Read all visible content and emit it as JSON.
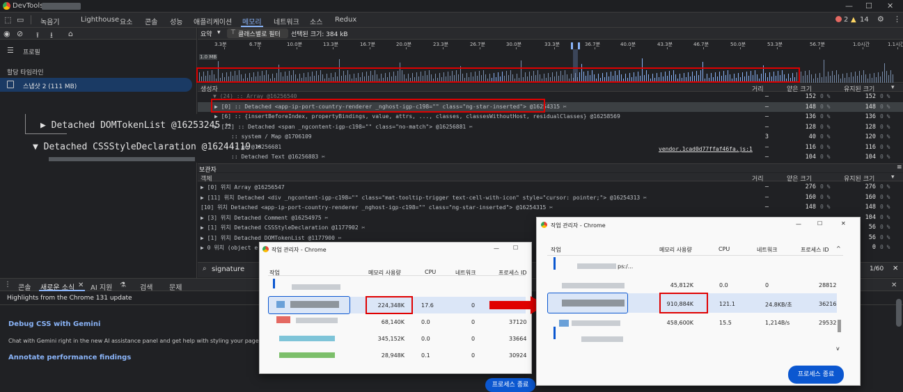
{
  "window": {
    "title": "DevTools - "
  },
  "tabs": [
    "녹음기",
    "Lighthouse",
    "요소",
    "콘솔",
    "성능",
    "애플리케이션",
    "메모리",
    "네트워크",
    "소스",
    "Redux"
  ],
  "issues": {
    "errors": "2",
    "warnings": "14"
  },
  "left": {
    "profiles_label": "프로필",
    "timeline_label": "할당 타임라인",
    "snapshot": "스냅샷 2 (111 MB)",
    "zoom1": "▶ Detached DOMTokenList @16253245 ✂",
    "zoom2": "▼ Detached CSSStyleDeclaration @16244119 ✂"
  },
  "toolbar": {
    "view": "요약",
    "filter": "클래스별로 필터",
    "selected_size": "선택된 크기: 384 kB"
  },
  "timeline": {
    "ticks": [
      "3.3분",
      "6.7분",
      "10.0분",
      "13.3분",
      "16.7분",
      "20.0분",
      "23.3분",
      "26.7분",
      "30.0분",
      "33.3분",
      "36.7분",
      "40.0분",
      "43.3분",
      "46.7분",
      "50.0분",
      "53.3분",
      "56.7분",
      "1.0시간",
      "1.1시간"
    ],
    "scale_label": "1.0 MB"
  },
  "constructor_grid": {
    "headers": {
      "name": "생성자",
      "distance": "거리",
      "shallow": "얕은 크기",
      "retained": "유지된 크기"
    },
    "rows": [
      {
        "text": "▼ (24) :: Array @16256540",
        "distance": "–",
        "shallow": "152",
        "sp": "0 %",
        "retained": "152",
        "rp": "0 %"
      },
      {
        "text": "▶ [0] :: Detached <app-ip-port-country-renderer _nghost-igp-c198=\"\" class=\"ng-star-inserted\"> @16254315 ✂",
        "distance": "–",
        "shallow": "148",
        "sp": "0 %",
        "retained": "148",
        "rp": "0 %"
      },
      {
        "text": "▶ [6] :: {insertBeforeIndex, propertyBindings, value, attrs, ..., classes, classesWithoutHost, residualClasses} @16258569",
        "distance": "–",
        "shallow": "136",
        "sp": "0 %",
        "retained": "136",
        "rp": "0 %"
      },
      {
        "text": "▶ [22] :: Detached <span _ngcontent-igp-c198=\"\" class=\"no-match\"> @16256881 ✂",
        "distance": "–",
        "shallow": "128",
        "sp": "0 %",
        "retained": "128",
        "rp": "0 %"
      },
      {
        "text": ":: system / Map @1706109",
        "distance": "3",
        "shallow": "40",
        "sp": "0 %",
        "retained": "120",
        "rp": "0 %"
      },
      {
        "text": ":: ge @16256681",
        "distance": "–",
        "shallow": "116",
        "sp": "0 %",
        "retained": "116",
        "rp": "0 %"
      },
      {
        "text": ":: Detached Text @16256883 ✂",
        "distance": "–",
        "shallow": "104",
        "sp": "0 %",
        "retained": "104",
        "rp": "0 %"
      }
    ],
    "link": "vendor.1cad0d77ffaf46fa.js:1"
  },
  "retainers_grid": {
    "title": "보관자",
    "headers": {
      "name": "객체",
      "distance": "거리",
      "shallow": "얕은 크기",
      "retained": "유지된 크기"
    },
    "rows": [
      {
        "text": "▶ [0] 위치 Array @16256547",
        "distance": "–",
        "shallow": "276",
        "sp": "0 %",
        "retained": "276",
        "rp": "0 %"
      },
      {
        "text": "▶ [11] 위치 Detached <div _ngcontent-igp-c198=\"\" class=\"mat-tooltip-trigger text-cell-with-icon\" style=\"cursor: pointer;\"> @16254313 ✂",
        "distance": "–",
        "shallow": "160",
        "sp": "0 %",
        "retained": "160",
        "rp": "0 %"
      },
      {
        "text": "[10] 위치 Detached <app-ip-port-country-renderer _nghost-igp-c198=\"\" class=\"ng-star-inserted\"> @16254315 ✂",
        "distance": "–",
        "shallow": "148",
        "sp": "0 %",
        "retained": "148",
        "rp": "0 %"
      },
      {
        "text": "▶ [3] 위치 Detached Comment @16254975 ✂",
        "distance": "–",
        "shallow": "",
        "sp": "",
        "retained": "104",
        "rp": "0 %"
      },
      {
        "text": "▶ [1] 위치 Detached CSSStyleDeclaration @1177902 ✂",
        "distance": "–",
        "shallow": "",
        "sp": "",
        "retained": "56",
        "rp": "0 %"
      },
      {
        "text": "▶ [1] 위치 Detached DOMTokenList @1177900 ✂",
        "distance": "–",
        "shallow": "",
        "sp": "",
        "retained": "56",
        "rp": "0 %"
      },
      {
        "text": "▶ 0 위치 (object e",
        "distance": "–",
        "shallow": "",
        "sp": "",
        "retained": "0",
        "rp": "0 %"
      }
    ]
  },
  "search": {
    "value": "signature",
    "count": "1/60"
  },
  "drawer": {
    "tabs": [
      "콘솔",
      "새로운 소식",
      "AI 지원",
      "검색",
      "문제"
    ],
    "highlights": "Highlights from the Chrome 131 update",
    "h1": "Debug CSS with Gemini",
    "p1": "Chat with Gemini right in the new AI assistance panel and get help with styling your page",
    "h2": "Annotate performance findings"
  },
  "tm1": {
    "title": "작업 관리자 - Chrome",
    "headers": {
      "task": "작업",
      "mem": "메모리 사용량",
      "cpu": "CPU",
      "net": "네트워크",
      "pid": "프로세스 ID"
    },
    "rows": [
      {
        "mem": "224,348K",
        "cpu": "17.6",
        "net": "0",
        "pid": ""
      },
      {
        "mem": "68,140K",
        "cpu": "0.0",
        "net": "0",
        "pid": "37120"
      },
      {
        "mem": "345,152K",
        "cpu": "0.0",
        "net": "0",
        "pid": "33664"
      },
      {
        "mem": "28,948K",
        "cpu": "0.1",
        "net": "0",
        "pid": "30924"
      }
    ],
    "end_btn": "프로세스 종료"
  },
  "tm2": {
    "title": "작업 관리자 - Chrome",
    "headers": {
      "task": "작업",
      "mem": "메모리 사용량",
      "cpu": "CPU",
      "net": "네트워크",
      "pid": "프로세스 ID"
    },
    "row0_text": "ps:/...",
    "rows": [
      {
        "mem": "45,812K",
        "cpu": "0.0",
        "net": "0",
        "pid": "28812"
      },
      {
        "mem": "910,884K",
        "cpu": "121.1",
        "net": "24.8KB/초",
        "pid": "36216"
      },
      {
        "mem": "458,600K",
        "cpu": "15.5",
        "net": "1,214B/s",
        "pid": "29532"
      }
    ],
    "end_btn": "프로세스 종료"
  }
}
